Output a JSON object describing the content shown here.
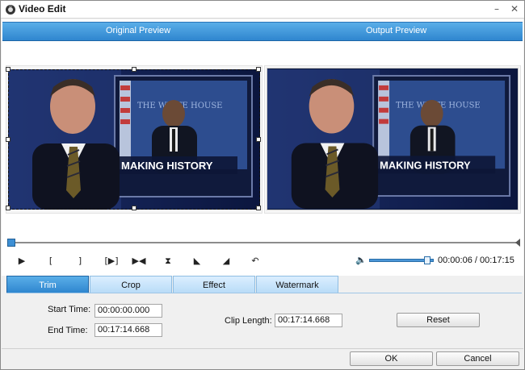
{
  "window": {
    "title": "Video Edit",
    "icon": "app-logo-icon"
  },
  "titlebar": {
    "minimize_glyph": "–",
    "close_glyph": "✕"
  },
  "preview": {
    "original_label": "Original Preview",
    "output_label": "Output Preview",
    "scene_caption": "MAKING HISTORY",
    "scene_backdrop_text": "THE WHITE HOUSE"
  },
  "timeline": {
    "position_fraction": 0.0
  },
  "controls": {
    "buttons": [
      {
        "name": "play-icon",
        "glyph": "▶"
      },
      {
        "name": "mark-in-icon",
        "glyph": "["
      },
      {
        "name": "mark-out-icon",
        "glyph": "]"
      },
      {
        "name": "play-selection-icon",
        "glyph": "[▶]"
      },
      {
        "name": "go-to-mark-icon",
        "glyph": "▶◀"
      },
      {
        "name": "split-icon",
        "glyph": "⧗"
      },
      {
        "name": "ramp-up-icon",
        "glyph": "◣"
      },
      {
        "name": "ramp-down-icon",
        "glyph": "◢"
      },
      {
        "name": "undo-icon",
        "glyph": "↶"
      }
    ],
    "volume_fraction": 0.9,
    "time_current": "00:00:06",
    "time_total": "00:17:15",
    "time_separator": "/"
  },
  "tabs": [
    {
      "label": "Trim",
      "active": true
    },
    {
      "label": "Crop",
      "active": false
    },
    {
      "label": "Effect",
      "active": false
    },
    {
      "label": "Watermark",
      "active": false
    }
  ],
  "trim": {
    "start_label": "Start Time:",
    "start_value": "00:00:00.000",
    "end_label": "End Time:",
    "end_value": "00:17:14.668",
    "clip_length_label": "Clip Length:",
    "clip_length_value": "00:17:14.668",
    "reset_label": "Reset"
  },
  "footer": {
    "ok_label": "OK",
    "cancel_label": "Cancel"
  },
  "colors": {
    "accent": "#2f86cf",
    "header_light": "#5aaee8",
    "tab_inactive": "#c9e4fa"
  }
}
